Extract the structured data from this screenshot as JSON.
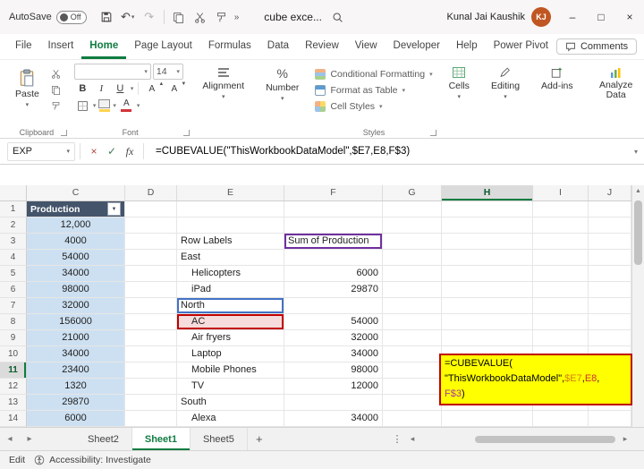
{
  "colors": {
    "accent_green": "#107C41",
    "col_c_fill": "#CDE0F1",
    "prod_header_fill": "#44546A",
    "overlay_fill": "#FFFF00",
    "overlay_border": "#C00000",
    "ref1": "#D2820F",
    "ref2": "#CC2F2F",
    "ref3": "#A8399E",
    "north_border": "#4472C4",
    "ac_border": "#C00000",
    "ac_fill": "#F6DCDC",
    "sum_border": "#7030A0",
    "avatar_fill": "#C05621"
  },
  "titlebar": {
    "autosave_label": "AutoSave",
    "autosave_state": "Off",
    "filename": "cube exce...",
    "user_name": "Kunal Jai Kaushik",
    "user_initials": "KJ"
  },
  "menubar": {
    "tabs": [
      "File",
      "Insert",
      "Home",
      "Page Layout",
      "Formulas",
      "Data",
      "Review",
      "View",
      "Developer",
      "Help",
      "Power Pivot"
    ],
    "active_tab": "Home",
    "comments_label": "Comments"
  },
  "ribbon": {
    "paste": "Paste",
    "clipboard": "Clipboard",
    "font_name": "",
    "font_size": "14",
    "font_group": "Font",
    "alignment": "Alignment",
    "number": "Number",
    "conditional_formatting": "Conditional Formatting",
    "format_as_table": "Format as Table",
    "cell_styles": "Cell Styles",
    "styles": "Styles",
    "cells": "Cells",
    "editing": "Editing",
    "addins": "Add-ins",
    "analyze_data": "Analyze Data"
  },
  "formula_bar": {
    "name_box": "EXP",
    "fx": "fx",
    "formula": "=CUBEVALUE(\"ThisWorkbookDataModel\",$E7,E8,F$3)"
  },
  "overlay_formula": {
    "line1": "=CUBEVALUE(",
    "model": "\"ThisWorkbookDataModel\",",
    "ref1": "$E7",
    "sep1": ",",
    "ref2": "E8",
    "sep2": ",",
    "ref3": "F$3",
    "close": ")"
  },
  "grid": {
    "col_headers": [
      "C",
      "D",
      "E",
      "F",
      "G",
      "H",
      "I",
      "J"
    ],
    "active_col": "H",
    "active_row": "11",
    "rows": [
      {
        "n": "1",
        "cells": {
          "C": {
            "v": "Production",
            "cls": "prod"
          }
        }
      },
      {
        "n": "2",
        "cells": {
          "C": {
            "v": "12,000",
            "cls": "cblue"
          }
        }
      },
      {
        "n": "3",
        "cells": {
          "C": {
            "v": "4000",
            "cls": "cblue"
          },
          "E": {
            "v": "Row Labels"
          },
          "F": {
            "v": "Sum of Production",
            "cls": "sumbox"
          }
        }
      },
      {
        "n": "4",
        "cells": {
          "C": {
            "v": "54000",
            "cls": "cblue"
          },
          "E": {
            "v": "East"
          }
        }
      },
      {
        "n": "5",
        "cells": {
          "C": {
            "v": "34000",
            "cls": "cblue"
          },
          "E": {
            "v": "Helicopters",
            "cls": "ind"
          },
          "F": {
            "v": "6000",
            "cls": "num"
          }
        }
      },
      {
        "n": "6",
        "cells": {
          "C": {
            "v": "98000",
            "cls": "cblue"
          },
          "E": {
            "v": "iPad",
            "cls": "ind"
          },
          "F": {
            "v": "29870",
            "cls": "num"
          }
        }
      },
      {
        "n": "7",
        "cells": {
          "C": {
            "v": "32000",
            "cls": "cblue"
          },
          "E": {
            "v": "North",
            "cls": "northbox"
          }
        }
      },
      {
        "n": "8",
        "cells": {
          "C": {
            "v": "156000",
            "cls": "cblue"
          },
          "E": {
            "v": "AC",
            "cls": "ind acbox"
          },
          "F": {
            "v": "54000",
            "cls": "num"
          }
        }
      },
      {
        "n": "9",
        "cells": {
          "C": {
            "v": "21000",
            "cls": "cblue"
          },
          "E": {
            "v": "Air fryers",
            "cls": "ind"
          },
          "F": {
            "v": "32000",
            "cls": "num"
          }
        }
      },
      {
        "n": "10",
        "cells": {
          "C": {
            "v": "34000",
            "cls": "cblue"
          },
          "E": {
            "v": "Laptop",
            "cls": "ind"
          },
          "F": {
            "v": "34000",
            "cls": "num"
          }
        }
      },
      {
        "n": "11",
        "cells": {
          "C": {
            "v": "23400",
            "cls": "cblue"
          },
          "E": {
            "v": "Mobile Phones",
            "cls": "ind"
          },
          "F": {
            "v": "98000",
            "cls": "num"
          }
        }
      },
      {
        "n": "12",
        "cells": {
          "C": {
            "v": "1320",
            "cls": "cblue"
          },
          "E": {
            "v": "TV",
            "cls": "ind"
          },
          "F": {
            "v": "12000",
            "cls": "num"
          }
        }
      },
      {
        "n": "13",
        "cells": {
          "C": {
            "v": "29870",
            "cls": "cblue"
          },
          "E": {
            "v": "South"
          }
        }
      },
      {
        "n": "14",
        "cells": {
          "C": {
            "v": "6000",
            "cls": "cblue"
          },
          "E": {
            "v": "Alexa",
            "cls": "ind"
          },
          "F": {
            "v": "34000",
            "cls": "num"
          }
        }
      }
    ]
  },
  "sheet_bar": {
    "tabs": [
      {
        "label": "Sheet2",
        "active": false
      },
      {
        "label": "Sheet1",
        "active": true
      },
      {
        "label": "Sheet5",
        "active": false
      }
    ],
    "add_label": "+"
  },
  "status_bar": {
    "mode": "Edit",
    "accessibility": "Accessibility: Investigate"
  }
}
